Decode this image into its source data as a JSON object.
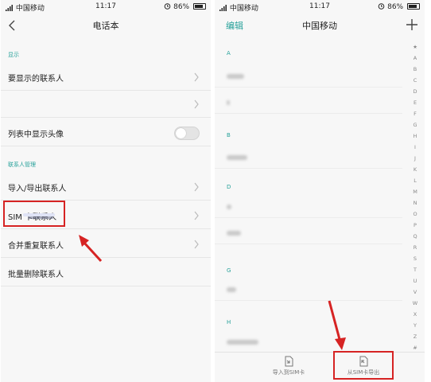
{
  "left": {
    "status": {
      "carrier": "中国移动",
      "time": "11:17",
      "battery": "86%"
    },
    "title": "电话本",
    "display_header": "显示",
    "rows": {
      "contacts_to_show": "要显示的联系人",
      "show_avatar": "列表中显示头像",
      "import_export": "导入/导出联系人",
      "sim_contacts": "SIM 卡联系人",
      "merge_duplicates": "合并重复联系人",
      "batch_delete": "批量删除联系人"
    },
    "manage_header": "联系人管理",
    "avatar_toggle_on": false
  },
  "right": {
    "status": {
      "carrier": "中国移动",
      "time": "11:17",
      "battery": "86%"
    },
    "edit": "编辑",
    "title": "中国移动",
    "letters": {
      "a": "A",
      "b": "B",
      "d": "D",
      "g": "G",
      "h": "H"
    },
    "index": [
      "★",
      "A",
      "B",
      "C",
      "D",
      "E",
      "F",
      "G",
      "H",
      "I",
      "J",
      "K",
      "L",
      "M",
      "N",
      "O",
      "P",
      "Q",
      "R",
      "S",
      "T",
      "U",
      "V",
      "W",
      "X",
      "Y",
      "Z",
      "#"
    ],
    "bottom": {
      "import_to_sim": "导入到SIM卡",
      "export_from_sim": "从SIM卡导出"
    }
  },
  "colors": {
    "accent": "#27a19a",
    "annotation": "#d62323"
  }
}
